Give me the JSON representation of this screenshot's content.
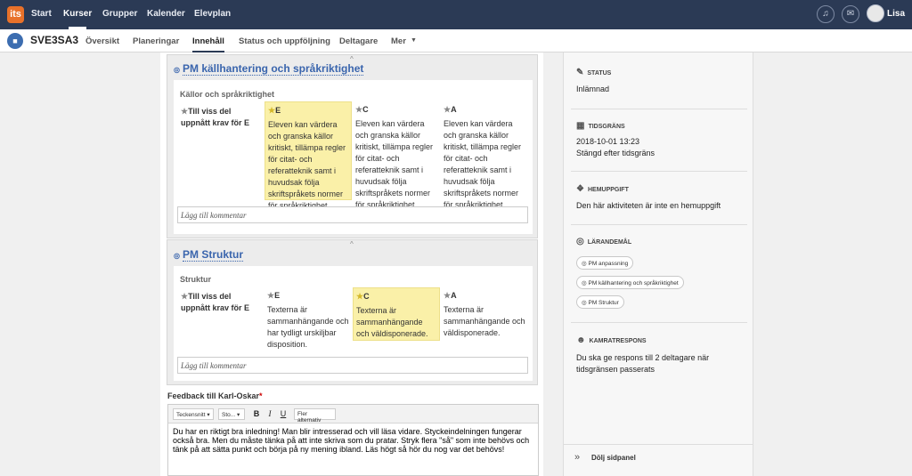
{
  "topnav": {
    "logo": "its",
    "items": [
      "Start",
      "Kurser",
      "Grupper",
      "Kalender",
      "Elevplan"
    ],
    "user": "Lisa"
  },
  "subnav": {
    "course": "SVE3SA3",
    "tabs": [
      "Översikt",
      "Planeringar",
      "Innehåll",
      "Status och uppföljning",
      "Deltagare",
      "Mer"
    ]
  },
  "sections": [
    {
      "title": "PM källhantering och språkriktighet",
      "rubric_name": "Källor och språkriktighet",
      "criterion": "Till viss del uppnått krav för E",
      "levels": [
        {
          "grade": "E",
          "text": "Eleven kan värdera och granska källor kritiskt, tillämpa regler för citat- och referatteknik samt i huvudsak följa skriftspråkets normer för språkriktighet."
        },
        {
          "grade": "C",
          "text": "Eleven kan värdera och granska källor kritiskt, tillämpa regler för citat- och referatteknik samt i huvudsak följa skriftspråkets normer för språkriktighet."
        },
        {
          "grade": "A",
          "text": "Eleven kan värdera och granska källor kritiskt, tillämpa regler för citat- och referatteknik samt i huvudsak följa skriftspråkets normer för språkriktighet."
        }
      ],
      "comment_placeholder": "Lägg till kommentar"
    },
    {
      "title": "PM Struktur",
      "rubric_name": "Struktur",
      "criterion": "Till viss del uppnått krav för E",
      "levels": [
        {
          "grade": "E",
          "text": "Texterna är sammanhängande och har tydligt urskiljbar disposition."
        },
        {
          "grade": "C",
          "text": "Texterna är sammanhängande och väldisponerade."
        },
        {
          "grade": "A",
          "text": "Texterna är sammanhängande och väldisponerade."
        }
      ],
      "comment_placeholder": "Lägg till kommentar"
    }
  ],
  "feedback": {
    "label": "Feedback till Karl-Oskar",
    "required_mark": "*",
    "toolbar": {
      "font": "Teckensnitt",
      "size": "Sto...",
      "bold": "B",
      "italic": "I",
      "underline": "U",
      "more": "Fler alternativ"
    },
    "text": "Du har en riktigt bra inledning! Man blir intresserad och vill läsa vidare. Styckeindelningen fungerar också bra. Men du måste tänka på att inte skriva som du pratar. Stryk flera \"så\" som inte behövs och tänk på att sätta punkt och börja på ny mening ibland. Läs högt så hör du nog var det behövs!"
  },
  "sidepanel": {
    "status_label": "Status",
    "status_value": "Inlämnad",
    "deadline_label": "Tidsgräns",
    "deadline_date": "2018-10-01 13:23",
    "deadline_note": "Stängd efter tidsgräns",
    "homework_label": "Hemuppgift",
    "homework_value": "Den här aktiviteten är inte en hemuppgift",
    "goals_label": "Lärandemål",
    "goals": [
      "PM anpassning",
      "PM källhantering och språkriktighet",
      "PM Struktur"
    ],
    "peer_label": "Kamratrespons",
    "peer_value": "Du ska ge respons till 2 deltagare när tidsgränsen passerats",
    "hide_label": "Dölj sidpanel"
  }
}
